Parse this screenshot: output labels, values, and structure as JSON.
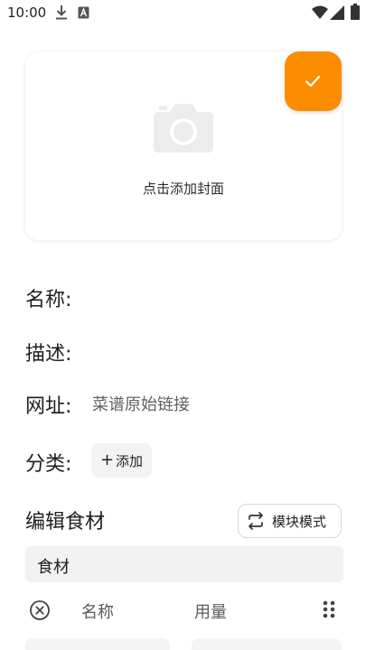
{
  "status_bar": {
    "time": "10:00",
    "icons": [
      "download-icon",
      "a-badge-icon",
      "wifi-icon",
      "signal-icon",
      "battery-icon"
    ]
  },
  "cover": {
    "prompt": "点击添加封面",
    "icon": "camera-icon"
  },
  "confirm": {
    "icon": "check-icon",
    "color": "#fb8c00"
  },
  "fields": {
    "name_label": "名称:",
    "desc_label": "描述:",
    "url_label": "网址:",
    "url_placeholder": "菜谱原始链接",
    "category_label": "分类:",
    "category_add": "添加"
  },
  "ingredients": {
    "title": "编辑食材",
    "mode_button": "模块模式",
    "group_label": "食材",
    "col_name": "名称",
    "col_qty": "用量"
  }
}
